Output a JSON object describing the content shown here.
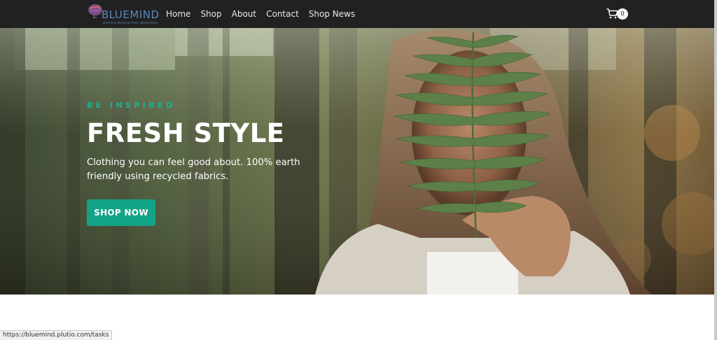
{
  "brand": {
    "name": "BLUEMIND",
    "tagline": "DIGITAL MARKETING SERVICES",
    "color": "#5b86b8"
  },
  "nav": {
    "items": [
      {
        "label": "Home"
      },
      {
        "label": "Shop"
      },
      {
        "label": "About"
      },
      {
        "label": "Contact"
      },
      {
        "label": "Shop News"
      }
    ]
  },
  "cart": {
    "icon": "cart-icon",
    "count": "0"
  },
  "hero": {
    "eyebrow": "BE INSPIRED",
    "title": "FRESH STYLE",
    "subtitle": "Clothing you can feel good about. 100% earth friendly using recycled fabrics.",
    "cta_label": "SHOP NOW",
    "accent_color": "#13a386",
    "image_subject": "woman holding fern leaf in forest"
  },
  "status_bar": {
    "url": "https://bluemind.plutio.com/tasks"
  }
}
